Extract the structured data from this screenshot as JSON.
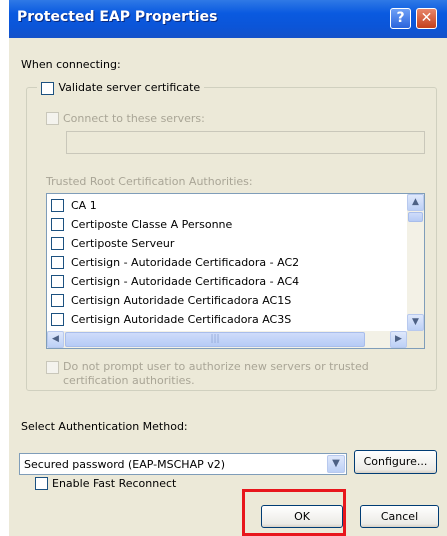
{
  "window": {
    "title": "Protected EAP Properties",
    "help_glyph": "?",
    "close_glyph": "✕"
  },
  "when_connecting_label": "When connecting:",
  "validate_cert": {
    "label": "Validate server certificate",
    "checked": false
  },
  "connect_servers": {
    "label": "Connect to these servers:",
    "checked": false,
    "enabled": false,
    "value": ""
  },
  "trusted_root": {
    "label": "Trusted Root Certification Authorities:",
    "items": [
      {
        "label": "CA 1",
        "checked": false
      },
      {
        "label": "Certiposte Classe A Personne",
        "checked": false
      },
      {
        "label": "Certiposte Serveur",
        "checked": false
      },
      {
        "label": "Certisign - Autoridade Certificadora - AC2",
        "checked": false
      },
      {
        "label": "Certisign - Autoridade Certificadora - AC4",
        "checked": false
      },
      {
        "label": "Certisign Autoridade Certificadora AC1S",
        "checked": false
      },
      {
        "label": "Certisign Autoridade Certificadora AC3S",
        "checked": false
      }
    ]
  },
  "no_prompt": {
    "label_line1": "Do not prompt user to authorize new servers or trusted",
    "label_line2": "certification authorities.",
    "checked": false,
    "enabled": false
  },
  "auth_method": {
    "label": "Select Authentication Method:",
    "selected": "Secured password (EAP-MSCHAP v2)",
    "configure_label": "Configure..."
  },
  "fast_reconnect": {
    "label": "Enable Fast Reconnect",
    "checked": false
  },
  "buttons": {
    "ok": "OK",
    "cancel": "Cancel"
  },
  "colors": {
    "title_bar": "#0a5ae0",
    "dialog_bg": "#ece9d8",
    "highlight": "#e8161c"
  }
}
